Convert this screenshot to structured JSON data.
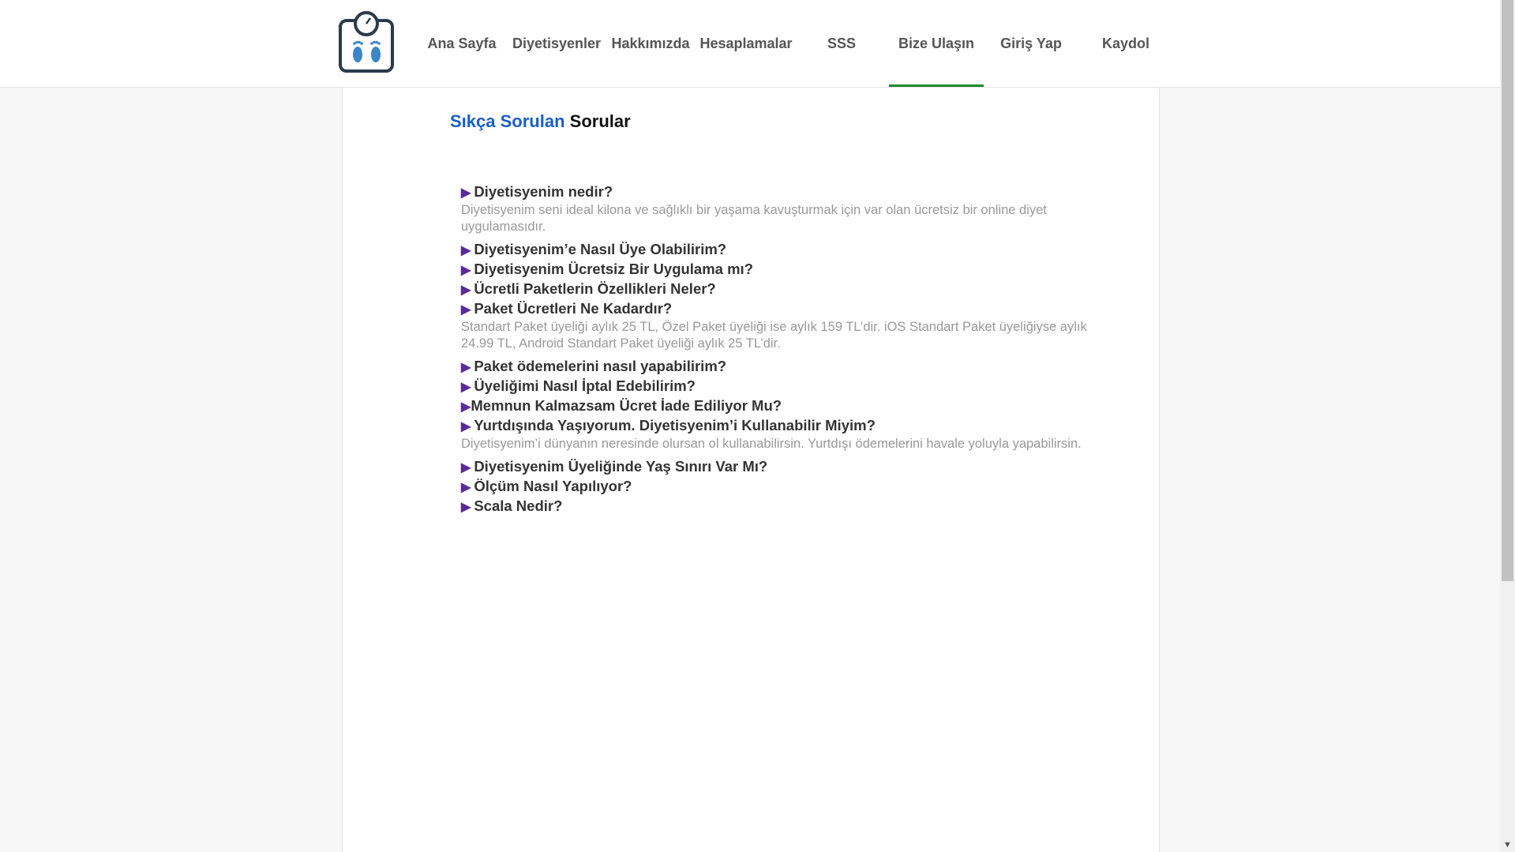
{
  "header": {
    "logo_icon": "scale-with-feet-icon",
    "nav": [
      {
        "label": "Ana Sayfa",
        "active": false
      },
      {
        "label": "Diyetisyenler",
        "active": false
      },
      {
        "label": "Hakkımızda",
        "active": false
      },
      {
        "label": "Hesaplamalar",
        "active": false
      },
      {
        "label": "SSS",
        "active": false
      },
      {
        "label": "Bize Ulaşın",
        "active": true
      },
      {
        "label": "Giriş Yap",
        "active": false
      },
      {
        "label": "Kaydol",
        "active": false
      }
    ],
    "active_color": "#1f8a2d"
  },
  "main": {
    "title_highlight": "Sıkça Sorulan",
    "title_rest": "Sorular",
    "title_color": "#1a5fc8",
    "arrow_glyph": "▶",
    "faq": [
      {
        "q": "Diyetisyenim nedir?",
        "a": "Diyetisyenim seni ideal kilona ve sağlıklı bir yaşama kavuşturmak için var olan ücretsiz bir online diyet uygulamasıdır."
      },
      {
        "q": "Diyetisyenim’e Nasıl Üye Olabilirim?"
      },
      {
        "q": "Diyetisyenim Ücretsiz Bir Uygulama mı?"
      },
      {
        "q": "Ücretli Paketlerin Özellikleri Neler?"
      },
      {
        "q": "Paket Ücretleri Ne Kadardır?",
        "a": "Standart Paket üyeliği aylık 25 TL, Özel Paket üyeliği ise aylık 159 TL’dir. iOS Standart Paket üyeliğiyse aylık 24.99 TL, Android Standart Paket üyeliği aylık 25 TL’dir."
      },
      {
        "q": "Paket ödemelerini nasıl yapabilirim?"
      },
      {
        "q": "Üyeliğimi Nasıl İptal Edebilirim?"
      },
      {
        "q": "Memnun Kalmazsam Ücret İade Ediliyor Mu?",
        "tight": true
      },
      {
        "q": "Yurtdışında Yaşıyorum. Diyetisyenim’i Kullanabilir Miyim?",
        "a": "Diyetisyenim’i dünyanın neresinde olursan ol kullanabilirsin. Yurtdışı ödemelerini havale yoluyla yapabilirsin."
      },
      {
        "q": "Diyetisyenim Üyeliğinde Yaş Sınırı Var Mı?"
      },
      {
        "q": "Ölçüm Nasıl Yapılıyor?"
      },
      {
        "q": "Scala Nedir?"
      }
    ]
  }
}
